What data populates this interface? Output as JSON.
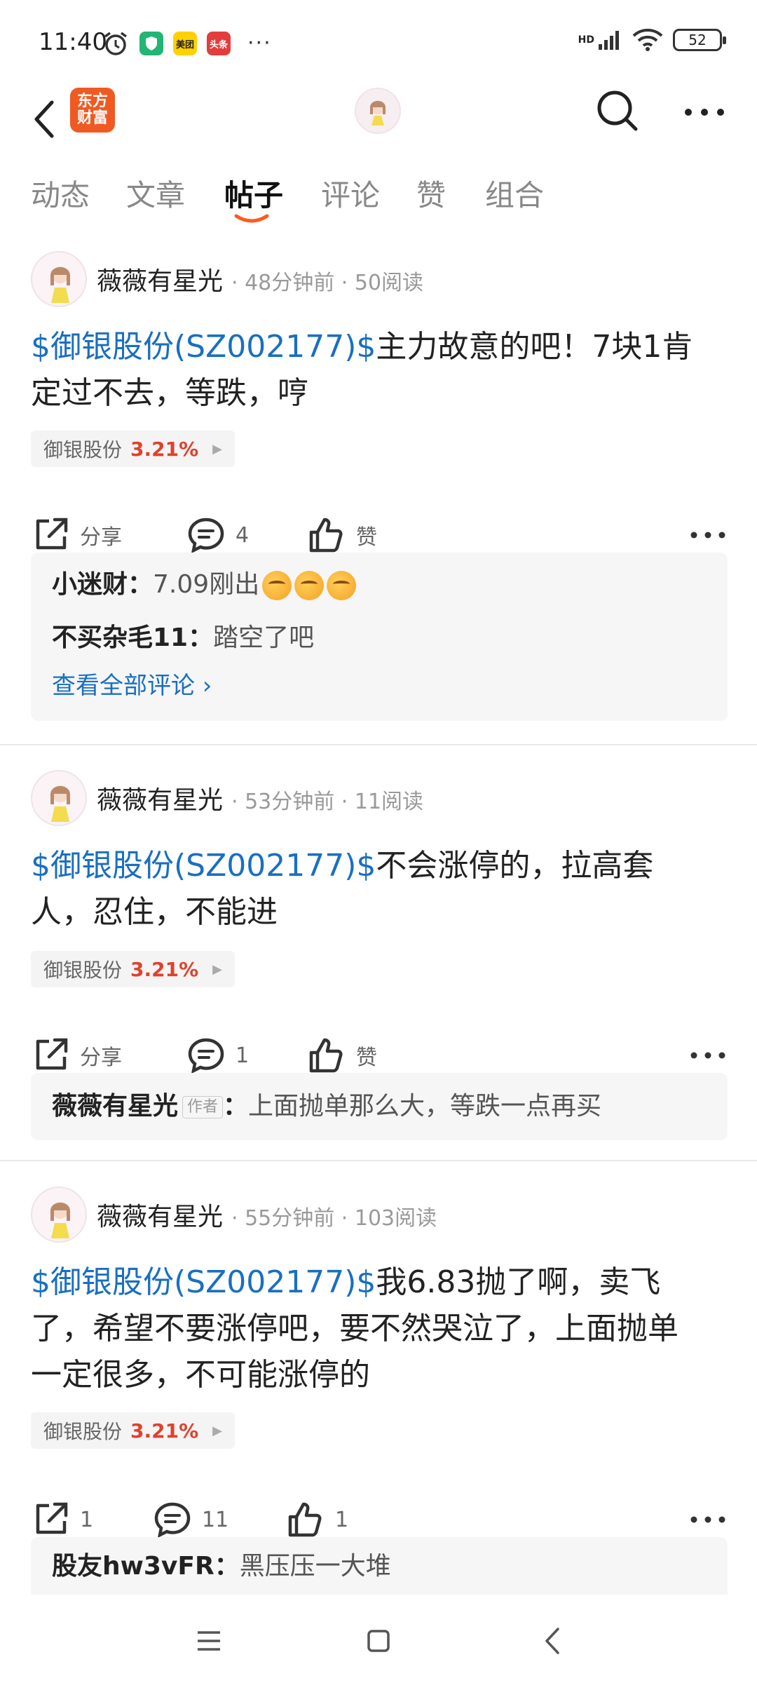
{
  "status_bar": {
    "time": "11:40",
    "apps": [
      "美团",
      "头条"
    ],
    "battery": "52",
    "network": "HD"
  },
  "header": {
    "brand_logo_text": "东方财富",
    "back_icon": "chevron-left-icon",
    "search_icon": "search-icon",
    "more_icon": "more-horizontal-icon"
  },
  "tabs": [
    {
      "label": "动态",
      "active": false
    },
    {
      "label": "文章",
      "active": false
    },
    {
      "label": "帖子",
      "active": true
    },
    {
      "label": "评论",
      "active": false
    },
    {
      "label": "赞",
      "active": false
    },
    {
      "label": "组合",
      "active": false
    }
  ],
  "colors": {
    "accent_blue": "#1a6fc0",
    "up_red": "#e0412c",
    "brand_orange": "#f05a22",
    "tab_underline": "#ff5a1f"
  },
  "posts": [
    {
      "author": "薇薇有星光",
      "meta": "· 48分钟前 · 50阅读",
      "stock_link": "$御银股份(SZ002177)$",
      "text_line1": "主力故意的吧！7块1肯",
      "text_line2": "定过不去，等跌，哼",
      "tag_name": "御银股份",
      "tag_pct": "3.21%",
      "share_label": "分享",
      "comment_count": "4",
      "like_label": "赞",
      "comments": [
        {
          "name": "小迷财",
          "text": "7.09刚出",
          "emoji_count": 3
        },
        {
          "name": "不买杂毛11",
          "text": "踏空了吧"
        }
      ],
      "view_all": "查看全部评论 ›"
    },
    {
      "author": "薇薇有星光",
      "meta": "· 53分钟前 · 11阅读",
      "stock_link": "$御银股份(SZ002177)$",
      "text_line1": "不会涨停的，拉高套",
      "text_line2": "人，忍住，不能进",
      "tag_name": "御银股份",
      "tag_pct": "3.21%",
      "share_label": "分享",
      "comment_count": "1",
      "like_label": "赞",
      "comments": [
        {
          "name": "薇薇有星光",
          "badge": "作者",
          "text": "上面抛单那么大，等跌一点再买"
        }
      ]
    },
    {
      "author": "薇薇有星光",
      "meta": "· 55分钟前 · 103阅读",
      "stock_link": "$御银股份(SZ002177)$",
      "text_line1": "我6.83抛了啊，卖飞",
      "text_line2": "了，希望不要涨停吧，要不然哭泣了，上面抛单",
      "text_line3": "一定很多，不可能涨停的",
      "tag_name": "御银股份",
      "tag_pct": "3.21%",
      "share_label": "1",
      "comment_count": "11",
      "like_label": "1",
      "comments": [
        {
          "name": "股友hw3vFR",
          "text": "黑压压一大堆"
        }
      ]
    }
  ]
}
